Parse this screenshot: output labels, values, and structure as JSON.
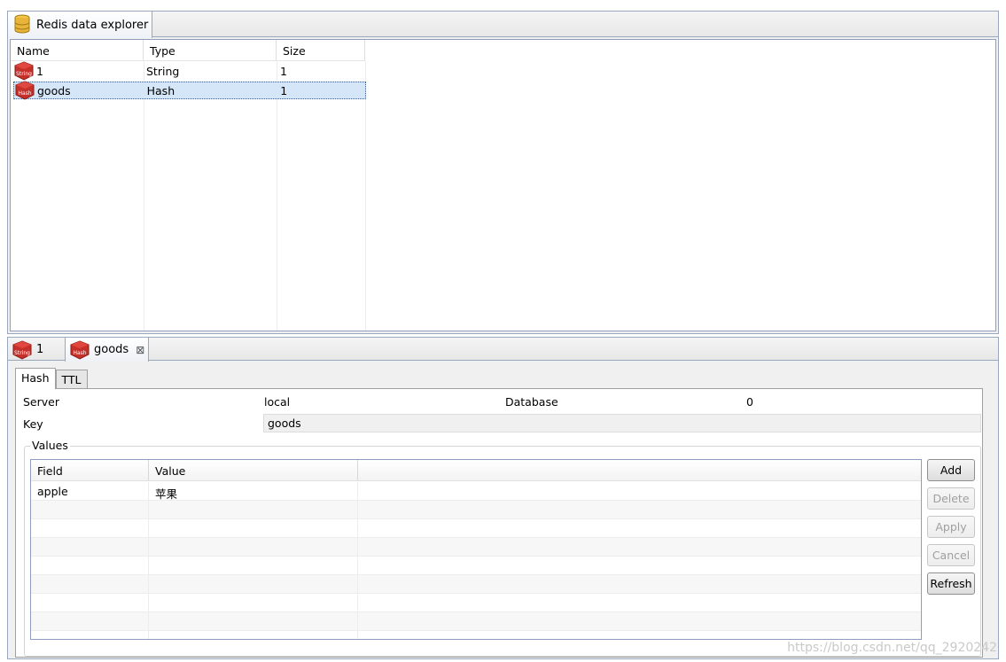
{
  "explorer": {
    "tab_title": "Redis data explorer",
    "icon": "database-icon",
    "columns": [
      "Name",
      "Type",
      "Size"
    ],
    "rows": [
      {
        "name": "1",
        "type": "String",
        "size": "1",
        "icon_badge": "String",
        "selected": false
      },
      {
        "name": "goods",
        "type": "Hash",
        "size": "1",
        "icon_badge": "Hash",
        "selected": true
      }
    ]
  },
  "editor": {
    "tabs": [
      {
        "label": "1",
        "icon_badge": "String",
        "active": false
      },
      {
        "label": "goods",
        "icon_badge": "Hash",
        "active": true,
        "close": "⊠"
      }
    ],
    "subtabs": [
      "Hash",
      "TTL"
    ],
    "server_label": "Server",
    "server_value": "local",
    "database_label": "Database",
    "database_value": "0",
    "key_label": "Key",
    "key_value": "goods",
    "values_legend": "Values",
    "values_columns": [
      "Field",
      "Value"
    ],
    "values_rows": [
      {
        "field": "apple",
        "value": "苹果"
      }
    ],
    "buttons": {
      "add": "Add",
      "delete": "Delete",
      "apply": "Apply",
      "cancel": "Cancel",
      "refresh": "Refresh"
    }
  },
  "watermark": "https://blog.csdn.net/qq_2920242",
  "colors": {
    "selection": "#d6e6f9",
    "panel_border": "#9aa8bd",
    "redis_red": "#c6302b"
  }
}
